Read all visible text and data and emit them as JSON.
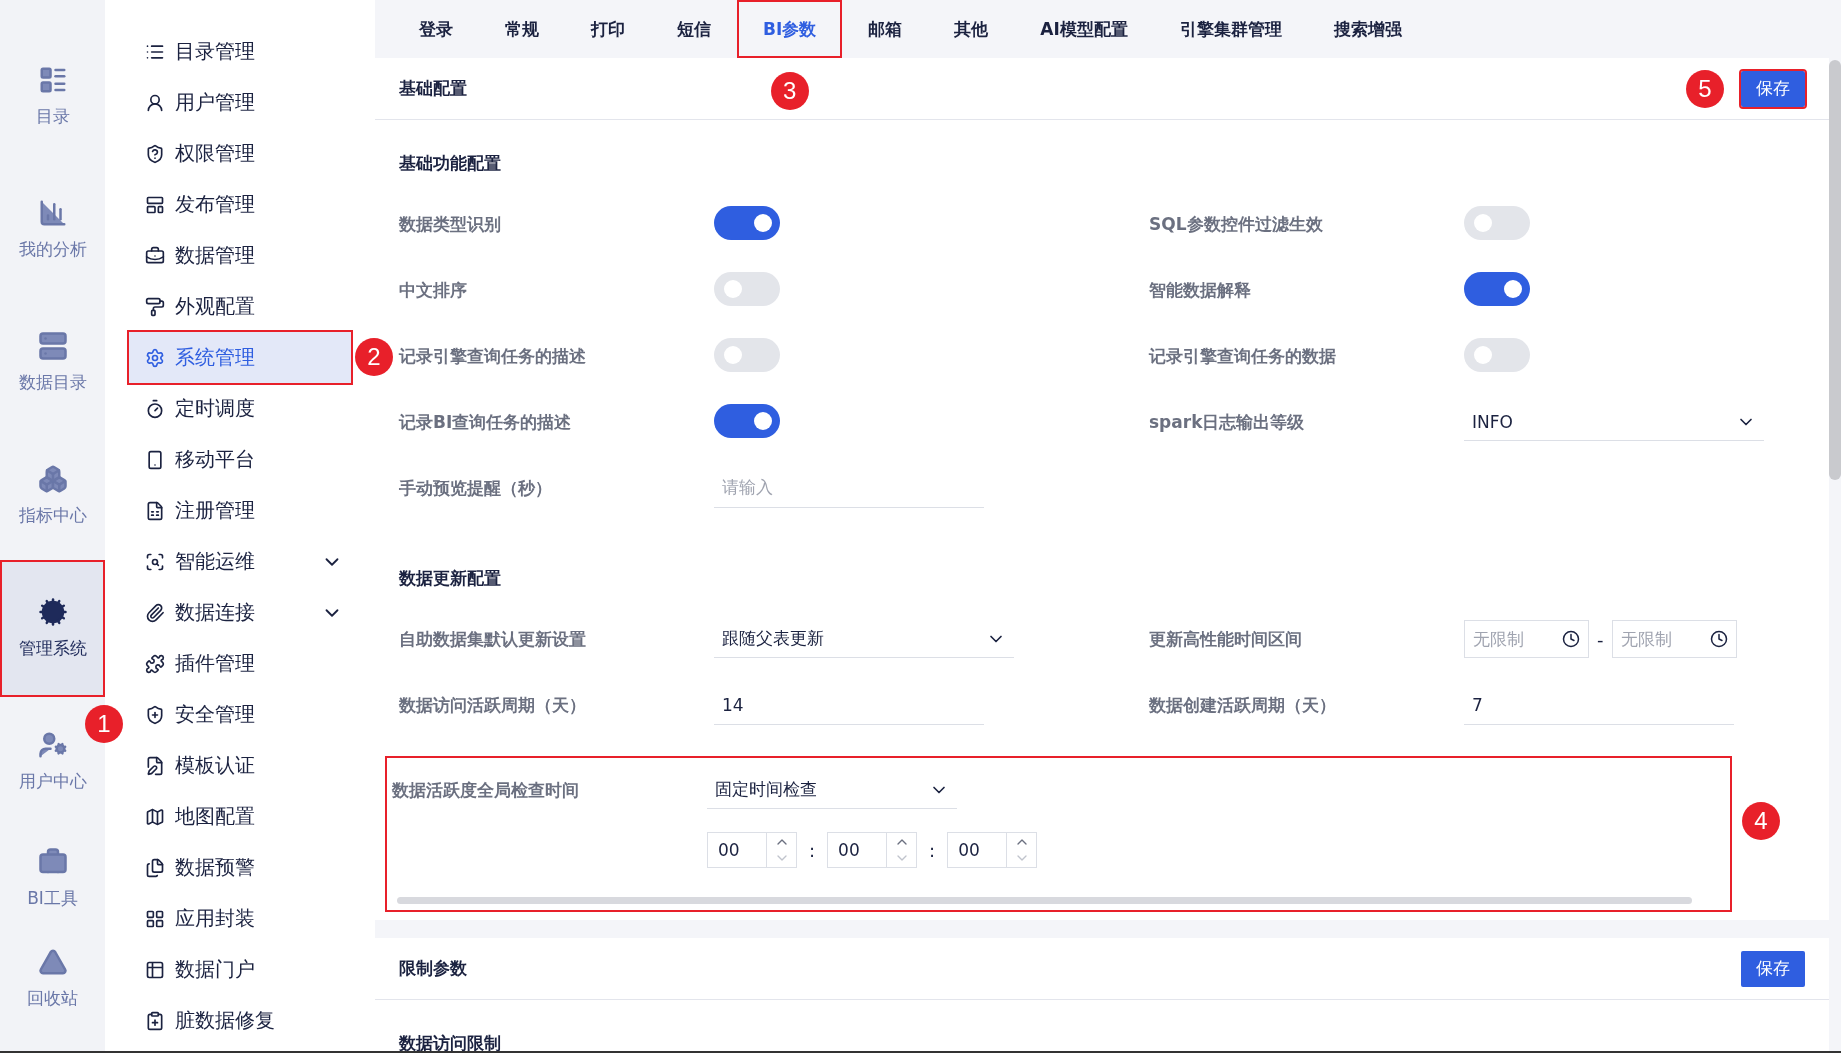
{
  "rail": [
    {
      "label": "目录",
      "selected": false,
      "highlighted": false
    },
    {
      "label": "我的分析",
      "selected": false,
      "highlighted": false
    },
    {
      "label": "数据目录",
      "selected": false,
      "highlighted": false
    },
    {
      "label": "指标中心",
      "selected": false,
      "highlighted": false
    },
    {
      "label": "管理系统",
      "selected": true,
      "highlighted": true,
      "callout": "1"
    },
    {
      "label": "用户中心",
      "selected": false,
      "highlighted": false
    },
    {
      "label": "BI工具",
      "selected": false,
      "highlighted": false
    },
    {
      "label": "回收站",
      "selected": false,
      "highlighted": false
    }
  ],
  "menu": [
    {
      "label": "目录管理",
      "selected": false,
      "highlighted": false,
      "expandable": false
    },
    {
      "label": "用户管理",
      "selected": false,
      "highlighted": false,
      "expandable": false
    },
    {
      "label": "权限管理",
      "selected": false,
      "highlighted": false,
      "expandable": false
    },
    {
      "label": "发布管理",
      "selected": false,
      "highlighted": false,
      "expandable": false
    },
    {
      "label": "数据管理",
      "selected": false,
      "highlighted": false,
      "expandable": false
    },
    {
      "label": "外观配置",
      "selected": false,
      "highlighted": false,
      "expandable": false
    },
    {
      "label": "系统管理",
      "selected": true,
      "highlighted": true,
      "expandable": false,
      "callout": "2"
    },
    {
      "label": "定时调度",
      "selected": false,
      "highlighted": false,
      "expandable": false
    },
    {
      "label": "移动平台",
      "selected": false,
      "highlighted": false,
      "expandable": false
    },
    {
      "label": "注册管理",
      "selected": false,
      "highlighted": false,
      "expandable": false
    },
    {
      "label": "智能运维",
      "selected": false,
      "highlighted": false,
      "expandable": true
    },
    {
      "label": "数据连接",
      "selected": false,
      "highlighted": false,
      "expandable": true
    },
    {
      "label": "插件管理",
      "selected": false,
      "highlighted": false,
      "expandable": false
    },
    {
      "label": "安全管理",
      "selected": false,
      "highlighted": false,
      "expandable": false
    },
    {
      "label": "模板认证",
      "selected": false,
      "highlighted": false,
      "expandable": false
    },
    {
      "label": "地图配置",
      "selected": false,
      "highlighted": false,
      "expandable": false
    },
    {
      "label": "数据预警",
      "selected": false,
      "highlighted": false,
      "expandable": false
    },
    {
      "label": "应用封装",
      "selected": false,
      "highlighted": false,
      "expandable": false
    },
    {
      "label": "数据门户",
      "selected": false,
      "highlighted": false,
      "expandable": false
    },
    {
      "label": "脏数据修复",
      "selected": false,
      "highlighted": false,
      "expandable": false
    }
  ],
  "tabs": [
    {
      "label": "登录",
      "selected": false,
      "highlighted": false
    },
    {
      "label": "常规",
      "selected": false,
      "highlighted": false
    },
    {
      "label": "打印",
      "selected": false,
      "highlighted": false
    },
    {
      "label": "短信",
      "selected": false,
      "highlighted": false
    },
    {
      "label": "BI参数",
      "selected": true,
      "highlighted": true,
      "callout": "3"
    },
    {
      "label": "邮箱",
      "selected": false,
      "highlighted": false
    },
    {
      "label": "其他",
      "selected": false,
      "highlighted": false
    },
    {
      "label": "AI模型配置",
      "selected": false,
      "highlighted": false
    },
    {
      "label": "引擎集群管理",
      "selected": false,
      "highlighted": false
    },
    {
      "label": "搜索增强",
      "selected": false,
      "highlighted": false
    }
  ],
  "basic_card": {
    "title": "基础配置",
    "save": {
      "label": "保存",
      "highlighted": true,
      "callout": "5"
    },
    "sections": [
      {
        "title": "基础功能配置",
        "rows": [
          {
            "kind": "toggle",
            "label": "数据类型识别",
            "on": true
          },
          {
            "kind": "toggle",
            "label": "SQL参数控件过滤生效",
            "on": false
          },
          {
            "kind": "toggle",
            "label": "中文排序",
            "on": false
          },
          {
            "kind": "toggle",
            "label": "智能数据解释",
            "on": true
          },
          {
            "kind": "toggle",
            "label": "记录引擎查询任务的描述",
            "on": false
          },
          {
            "kind": "toggle",
            "label": "记录引擎查询任务的数据",
            "on": false
          },
          {
            "kind": "toggle",
            "label": "记录BI查询任务的描述",
            "on": true
          },
          {
            "kind": "select",
            "label": "spark日志输出等级",
            "value": "INFO"
          },
          {
            "kind": "input",
            "label": "手动预览提醒（秒）",
            "placeholder": "请输入"
          }
        ]
      },
      {
        "title": "数据更新配置",
        "rows": [
          {
            "kind": "select",
            "label": "自助数据集默认更新设置",
            "value": "跟随父表更新"
          },
          {
            "kind": "time_range",
            "label": "更新高性能时间区间",
            "start_placeholder": "无限制",
            "separator": "-",
            "end_placeholder": "无限制"
          },
          {
            "kind": "input",
            "label": "数据访问活跃周期（天）",
            "value": "14"
          },
          {
            "kind": "input",
            "label": "数据创建活跃周期（天）",
            "value": "7"
          }
        ]
      }
    ],
    "check_group": {
      "highlighted": true,
      "callout": "4",
      "label": "数据活跃度全局检查时间",
      "value": "固定时间检查",
      "time_fields": [
        "00",
        "00",
        "00"
      ],
      "separator": ":"
    }
  },
  "limit_card": {
    "title": "限制参数",
    "save": {
      "label": "保存"
    },
    "section_title": "数据访问限制"
  }
}
